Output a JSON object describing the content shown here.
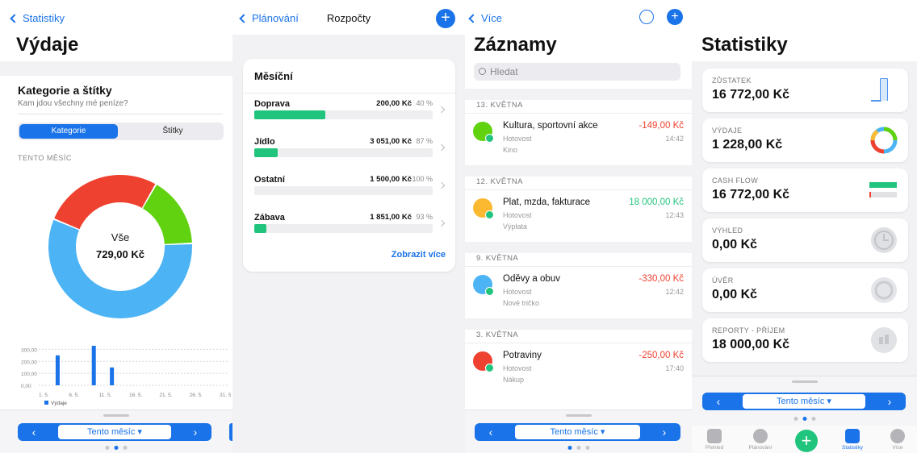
{
  "colors": {
    "accent": "#1a73e8",
    "green": "#21c47c",
    "red": "#ef4130",
    "lightgreen": "#60d210",
    "lightblue": "#4cb4f5",
    "yellow": "#fbb931"
  },
  "screen1": {
    "back": "Statistiky",
    "title": "Výdaje",
    "card_title": "Kategorie a štítky",
    "card_sub": "Kam jdou všechny mé peníze?",
    "seg": [
      "Kategorie",
      "Štítky"
    ],
    "period": "TENTO MĚSÍC",
    "donut_label": "Vše",
    "donut_value": "729,00 Kč",
    "pager": "Tento měsíc",
    "chart_data": {
      "type": "bar",
      "categories": [
        "1. 5.",
        "6. 5.",
        "11. 5.",
        "16. 5.",
        "21. 5.",
        "26. 5.",
        "31. 5."
      ],
      "x_days": [
        3,
        9,
        12
      ],
      "values": [
        250,
        330,
        149
      ],
      "yticks": [
        "300,00",
        "200,00",
        "100,00",
        "0,00"
      ],
      "ylim": [
        0,
        350
      ],
      "series": [
        {
          "name": "Výdaje",
          "values": [
            250,
            330,
            149
          ]
        }
      ]
    },
    "donut_data": {
      "type": "pie",
      "values": [
        16,
        57,
        27
      ],
      "colors": [
        "#60d210",
        "#4cb4f5",
        "#ef4130"
      ]
    }
  },
  "screen2": {
    "back": "Plánování",
    "title": "Rozpočty",
    "card_title": "Měsíční",
    "rows": [
      {
        "name": "Doprava",
        "amount": "200,00 Kč",
        "pct": "40 %",
        "fill": 40
      },
      {
        "name": "Jídlo",
        "amount": "3 051,00 Kč",
        "pct": "87 %",
        "fill": 13
      },
      {
        "name": "Ostatní",
        "amount": "1 500,00 Kč",
        "pct": "100 %",
        "fill": 0
      },
      {
        "name": "Zábava",
        "amount": "1 851,00 Kč",
        "pct": "93 %",
        "fill": 7
      }
    ],
    "more": "Zobrazit více"
  },
  "screen3": {
    "back": "Více",
    "title": "Záznamy",
    "search_placeholder": "Hledat",
    "groups": [
      {
        "date": "13. KVĚTNA",
        "title": "Kultura, sportovní akce",
        "amount": "-149,00 Kč",
        "account": "Hotovost",
        "note": "Kino",
        "time": "14:42"
      },
      {
        "date": "12. KVĚTNA",
        "title": "Plat, mzda, fakturace",
        "amount": "18 000,00 Kč",
        "account": "Hotovost",
        "note": "Výplata",
        "time": "12:43"
      },
      {
        "date": "9. KVĚTNA",
        "title": "Oděvy a obuv",
        "amount": "-330,00 Kč",
        "account": "Hotovost",
        "note": "Nové tričko",
        "time": "12:42"
      },
      {
        "date": "3. KVĚTNA",
        "title": "Potraviny",
        "amount": "-250,00 Kč",
        "account": "Hotovost",
        "note": "Nákup",
        "time": "17:40"
      }
    ],
    "pager": "Tento měsíc"
  },
  "screen4": {
    "title": "Statistiky",
    "cards": [
      {
        "label": "ZŮSTATEK",
        "value": "16 772,00 Kč"
      },
      {
        "label": "VÝDAJE",
        "value": "1 228,00 Kč"
      },
      {
        "label": "CASH FLOW",
        "value": "16 772,00 Kč"
      },
      {
        "label": "VÝHLED",
        "value": "0,00 Kč"
      },
      {
        "label": "ÚVĚR",
        "value": "0,00 Kč"
      },
      {
        "label": "REPORTY - PŘÍJEM",
        "value": "18 000,00 Kč"
      }
    ],
    "pager": "Tento měsíc",
    "tabs": [
      "Přehled",
      "Plánování",
      "",
      "Statistiky",
      "Více"
    ]
  }
}
